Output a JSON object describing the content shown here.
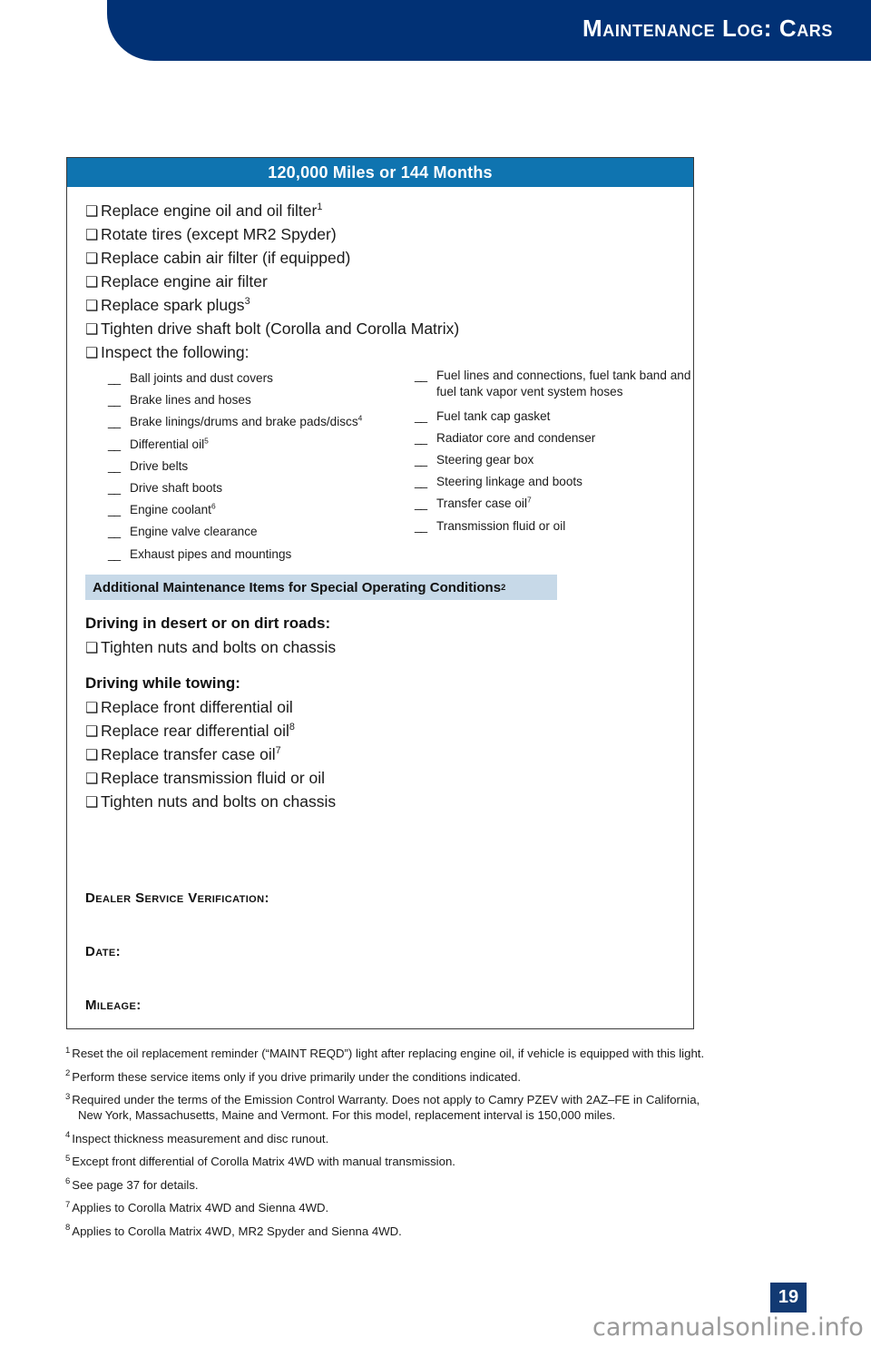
{
  "header": {
    "title": "Maintenance Log: Cars",
    "banner_color": "#013175"
  },
  "interval": {
    "title": "120,000 Miles or 144 Months",
    "title_bar_color": "#0f74b0"
  },
  "checkbox_glyph": "❑",
  "dash_glyph": "__",
  "main_items": [
    {
      "label": "Replace engine oil and oil filter",
      "note": "1"
    },
    {
      "label": "Rotate tires (except MR2 Spyder)",
      "note": ""
    },
    {
      "label": "Replace cabin air filter (if equipped)",
      "note": ""
    },
    {
      "label": "Replace engine air filter",
      "note": ""
    },
    {
      "label": "Replace spark plugs",
      "note": "3"
    },
    {
      "label": "Tighten drive shaft bolt (Corolla and Corolla Matrix)",
      "note": ""
    },
    {
      "label": "Inspect the following:",
      "note": ""
    }
  ],
  "inspect": {
    "left_column": [
      {
        "label": "Ball joints and dust covers",
        "note": ""
      },
      {
        "label": "Brake lines and hoses",
        "note": ""
      },
      {
        "label": "Brake linings/drums and brake pads/discs",
        "note": "4"
      },
      {
        "label": "Differential oil",
        "note": "5"
      },
      {
        "label": "Drive belts",
        "note": ""
      },
      {
        "label": "Drive shaft boots",
        "note": ""
      },
      {
        "label": "Engine coolant",
        "note": "6"
      },
      {
        "label": "Engine valve clearance",
        "note": ""
      },
      {
        "label": "Exhaust pipes and mountings",
        "note": ""
      }
    ],
    "right_column": [
      {
        "label": "Fuel lines and connections, fuel tank band and fuel tank vapor vent system hoses",
        "note": ""
      },
      {
        "label": "Fuel tank cap gasket",
        "note": ""
      },
      {
        "label": "Radiator core and condenser",
        "note": ""
      },
      {
        "label": "Steering gear box",
        "note": ""
      },
      {
        "label": "Steering linkage and boots",
        "note": ""
      },
      {
        "label": "Transfer case oil",
        "note": "7"
      },
      {
        "label": "Transmission fluid or oil",
        "note": ""
      }
    ]
  },
  "additional": {
    "band_label": "Additional Maintenance Items for Special Operating Conditions",
    "band_note": "2",
    "band_color": "#c7d9e8",
    "groups": [
      {
        "heading": "Driving in desert or on dirt roads:",
        "items": [
          {
            "label": "Tighten nuts and bolts on chassis",
            "note": ""
          }
        ]
      },
      {
        "heading": "Driving while towing:",
        "items": [
          {
            "label": "Replace front differential oil",
            "note": ""
          },
          {
            "label": "Replace rear differential oil",
            "note": "8"
          },
          {
            "label": "Replace transfer case oil",
            "note": "7"
          },
          {
            "label": "Replace transmission fluid or oil",
            "note": ""
          },
          {
            "label": "Tighten nuts and bolts on chassis",
            "note": ""
          }
        ]
      }
    ]
  },
  "verification": {
    "dealer_label": "Dealer Service Verification:",
    "date_label": "Date:",
    "mileage_label": "Mileage:"
  },
  "footnotes": [
    {
      "num": "1",
      "text": "Reset the oil replacement reminder (“MAINT REQD”) light after replacing engine oil, if vehicle is equipped with this light.",
      "cont": ""
    },
    {
      "num": "2",
      "text": "Perform these service items only if you drive primarily under the conditions indicated.",
      "cont": ""
    },
    {
      "num": "3",
      "text": "Required under the terms of the Emission Control Warranty. Does not apply to Camry PZEV with 2AZ–FE in California,",
      "cont": "New York, Massachusetts, Maine and Vermont. For this model, replacement interval is 150,000 miles."
    },
    {
      "num": "4",
      "text": "Inspect thickness measurement and disc runout.",
      "cont": ""
    },
    {
      "num": "5",
      "text": "Except front differential of Corolla Matrix 4WD with manual transmission.",
      "cont": ""
    },
    {
      "num": "6",
      "text": "See page 37 for details.",
      "cont": ""
    },
    {
      "num": "7",
      "text": "Applies to Corolla Matrix 4WD and Sienna 4WD.",
      "cont": ""
    },
    {
      "num": "8",
      "text": "Applies to Corolla Matrix 4WD, MR2 Spyder and Sienna 4WD.",
      "cont": ""
    }
  ],
  "page": {
    "number": "19",
    "badge_color": "#123a73"
  },
  "watermark": {
    "text": "carmanualsonline.info"
  }
}
